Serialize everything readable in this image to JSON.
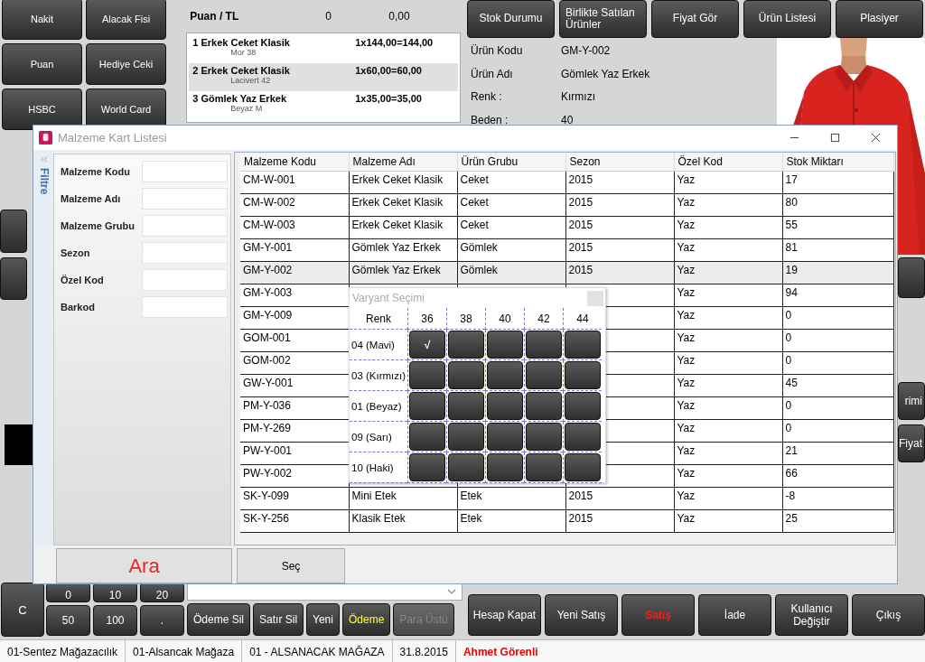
{
  "payment_buttons": [
    "Nakit",
    "Alacak Fisi",
    "Puan",
    "Hediye Ceki",
    "HSBC",
    "World Card"
  ],
  "points": {
    "label": "Puan / TL",
    "count": "0",
    "amount": "0,00"
  },
  "receipt_lines": [
    {
      "title": "1 Erkek Ceket Klasik",
      "price": "1x144,00=144,00",
      "variant": "Mor 38",
      "selected": false
    },
    {
      "title": "2 Erkek Ceket Klasik",
      "price": "1x60,00=60,00",
      "variant": "Lacivert 42",
      "selected": true
    },
    {
      "title": "3 Gömlek Yaz Erkek",
      "price": "1x35,00=35,00",
      "variant": "Beyaz M",
      "selected": false
    }
  ],
  "toolbar_buttons": [
    "Stok Durumu",
    "Birlikte Satılan Ürünler",
    "Fiyat Gör",
    "Ürün Listesi",
    "Plasiyer"
  ],
  "product_info": [
    {
      "label": "Ürün Kodu",
      "value": "GM-Y-002"
    },
    {
      "label": "Ürün Adı",
      "value": "Gömlek Yaz Erkek"
    },
    {
      "label": "Renk :",
      "value": "Kırmızı"
    },
    {
      "label": "Beden :",
      "value": "40"
    }
  ],
  "side_buttons": [
    "rimi",
    "Fiyat"
  ],
  "keypad": {
    "clear": "C",
    "keys": [
      "0",
      "10",
      "20",
      "50",
      "100",
      "."
    ]
  },
  "payment_actions": [
    {
      "label": "Ödeme Sil",
      "kind": "normal",
      "disabled": false
    },
    {
      "label": "Satır Sil",
      "kind": "normal",
      "disabled": false
    },
    {
      "label": "Yeni",
      "kind": "normal",
      "disabled": false
    },
    {
      "label": "Ödeme",
      "kind": "highlight",
      "disabled": false
    },
    {
      "label": "Para Üstü",
      "kind": "normal",
      "disabled": true
    }
  ],
  "main_actions": [
    {
      "label": "Hesap Kapat",
      "kind": "normal"
    },
    {
      "label": "Yeni Satış",
      "kind": "normal"
    },
    {
      "label": "Satış",
      "kind": "alert"
    },
    {
      "label": "İade",
      "kind": "normal"
    },
    {
      "label": "Kullanıcı Değiştir",
      "kind": "normal"
    },
    {
      "label": "Çıkış",
      "kind": "normal"
    }
  ],
  "status_bar": [
    {
      "text": "01-Sentez Mağazacılık",
      "kind": "plain"
    },
    {
      "text": "01-Alsancak Mağaza",
      "kind": "plain"
    },
    {
      "text": "01 - ALSANACAK MAĞAZA",
      "kind": "plain"
    },
    {
      "text": "31.8.2015",
      "kind": "plain"
    },
    {
      "text": "Ahmet Görenli",
      "kind": "user"
    }
  ],
  "dialog": {
    "title": "Malzeme Kart Listesi",
    "filter_tab": "Filtre",
    "filters": [
      "Malzeme Kodu",
      "Malzeme Adı",
      "Malzeme Grubu",
      "Sezon",
      "Özel Kod",
      "Barkod"
    ],
    "search_button": "Ara",
    "select_button": "Seç",
    "table": {
      "columns": [
        "Malzeme Kodu",
        "Malzeme Adı",
        "Ürün Grubu",
        "Sezon",
        "Özel Kod",
        "Stok Miktarı"
      ],
      "rows": [
        {
          "cells": [
            "CM-W-001",
            "Erkek Ceket Klasik",
            "Ceket",
            "2015",
            "Yaz",
            "17"
          ],
          "selected": false
        },
        {
          "cells": [
            "CM-W-002",
            "Erkek Ceket Klasik",
            "Ceket",
            "2015",
            "Yaz",
            "80"
          ],
          "selected": false
        },
        {
          "cells": [
            "CM-W-003",
            "Erkek Ceket Klasik",
            "Ceket",
            "2015",
            "Yaz",
            "55"
          ],
          "selected": false
        },
        {
          "cells": [
            "GM-Y-001",
            "Gömlek Yaz Erkek",
            "Gömlek",
            "2015",
            "Yaz",
            "81"
          ],
          "selected": false
        },
        {
          "cells": [
            "GM-Y-002",
            "Gömlek Yaz Erkek",
            "Gömlek",
            "2015",
            "Yaz",
            "19"
          ],
          "selected": true
        },
        {
          "cells": [
            "GM-Y-003",
            null,
            null,
            null,
            "Yaz",
            "94"
          ],
          "selected": false
        },
        {
          "cells": [
            "GM-Y-009",
            null,
            null,
            null,
            "Yaz",
            "0"
          ],
          "selected": false
        },
        {
          "cells": [
            "GOM-001",
            null,
            null,
            null,
            "Yaz",
            "0"
          ],
          "selected": false
        },
        {
          "cells": [
            "GOM-002",
            null,
            null,
            null,
            "Yaz",
            "0"
          ],
          "selected": false
        },
        {
          "cells": [
            "GW-Y-001",
            null,
            null,
            null,
            "Yaz",
            "45"
          ],
          "selected": false
        },
        {
          "cells": [
            "PM-Y-036",
            null,
            null,
            null,
            "Yaz",
            "0"
          ],
          "selected": false
        },
        {
          "cells": [
            "PM-Y-269",
            null,
            null,
            null,
            "Yaz",
            "0"
          ],
          "selected": false
        },
        {
          "cells": [
            "PW-Y-001",
            null,
            null,
            null,
            "Yaz",
            "21"
          ],
          "selected": false
        },
        {
          "cells": [
            "PW-Y-002",
            null,
            null,
            null,
            "Yaz",
            "66"
          ],
          "selected": false
        },
        {
          "cells": [
            "SK-Y-099",
            "Mini Etek",
            "Etek",
            "2015",
            "Yaz",
            "-8"
          ],
          "selected": false
        },
        {
          "cells": [
            "SK-Y-256",
            "Klasik Etek",
            "Etek",
            "2015",
            "Yaz",
            "25"
          ],
          "selected": false
        }
      ]
    }
  },
  "variant_popup": {
    "title": "Varyant Seçimi",
    "corner": "Renk",
    "check_mark": "√",
    "sizes": [
      "36",
      "38",
      "40",
      "42",
      "44"
    ],
    "rows": [
      {
        "name": "04 (Mavi)",
        "cells": [
          {
            "checked": true
          },
          {
            "checked": false
          },
          {
            "checked": false
          },
          {
            "checked": false
          },
          {
            "checked": false
          }
        ]
      },
      {
        "name": "03 (Kırmızı)",
        "cells": [
          {
            "checked": false
          },
          {
            "checked": false
          },
          {
            "checked": false
          },
          {
            "checked": false
          },
          {
            "checked": false
          }
        ]
      },
      {
        "name": "01 (Beyaz)",
        "cells": [
          {
            "checked": false
          },
          {
            "checked": false
          },
          {
            "checked": false
          },
          {
            "checked": false
          },
          {
            "checked": false
          }
        ]
      },
      {
        "name": "09 (Sarı)",
        "cells": [
          {
            "checked": false
          },
          {
            "checked": false
          },
          {
            "checked": false
          },
          {
            "checked": false
          },
          {
            "checked": false
          }
        ]
      },
      {
        "name": "10 (Haki)",
        "cells": [
          {
            "checked": false
          },
          {
            "checked": false
          },
          {
            "checked": false
          },
          {
            "checked": false
          },
          {
            "checked": false
          }
        ]
      }
    ]
  }
}
